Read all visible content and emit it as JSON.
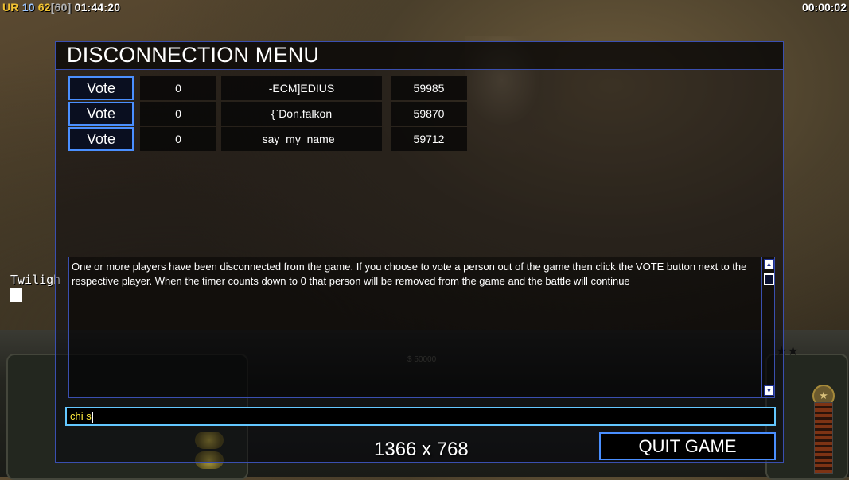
{
  "hud": {
    "ur": "UR",
    "ur_value": "10",
    "fps": "62",
    "fps_cap": "[60]",
    "clock": "01:44:20",
    "game_timer": "00:00:02"
  },
  "side": {
    "text": "Twiligh"
  },
  "control_bar": {
    "money": "$ 50000",
    "stars": "★★"
  },
  "dialog": {
    "title": "DISCONNECTION MENU",
    "rows": [
      {
        "vote_label": "Vote",
        "votes": "0",
        "player": "-ECM]EDIUS",
        "ping": "59985"
      },
      {
        "vote_label": "Vote",
        "votes": "0",
        "player": "{`Don.falkon",
        "ping": "59870"
      },
      {
        "vote_label": "Vote",
        "votes": "0",
        "player": "say_my_name_",
        "ping": "59712"
      }
    ],
    "message": "One or more players have been disconnected from the game. If you choose to vote a person out of the game then click the VOTE button next to the respective player. When the timer counts down to 0 that person will be removed from the game and the battle will continue",
    "chat_value": "chi s",
    "quit_label": "QUIT GAME"
  },
  "overlay": {
    "resolution": "1366 x 768"
  },
  "colors": {
    "accent_border": "#4a8fff",
    "chat_border": "#63c7ff",
    "chat_text": "#ffea3c",
    "fps_yellow": "#f1c232"
  }
}
